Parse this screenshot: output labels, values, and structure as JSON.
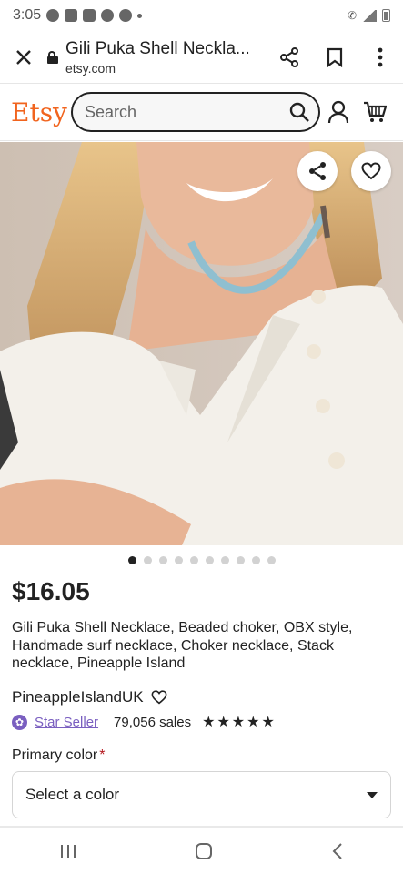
{
  "status_bar": {
    "time": "3:05",
    "icons": [
      "messenger-icon",
      "facebook-icon",
      "facebook-icon",
      "soccer-icon",
      "account-icon",
      "dot"
    ]
  },
  "browser": {
    "page_title": "Gili Puka Shell Neckla...",
    "domain": "etsy.com",
    "actions": [
      "share-icon",
      "bookmark-icon",
      "more-icon"
    ]
  },
  "header": {
    "logo": "Etsy",
    "search_placeholder": "Search",
    "brand_color": "#F1641E"
  },
  "product": {
    "gallery": {
      "image_count": 10,
      "active_index": 0
    },
    "price": "$16.05",
    "title": "Gili Puka Shell Necklace, Beaded choker, OBX style, Handmade surf necklace, Choker necklace, Stack necklace, Pineapple Island",
    "shop_name": "PineappleIslandUK",
    "star_seller_label": "Star Seller",
    "sales": "79,056 sales",
    "rating_stars": 5
  },
  "variation": {
    "label": "Primary color",
    "required_mark": "*",
    "selected": "Select a color"
  }
}
